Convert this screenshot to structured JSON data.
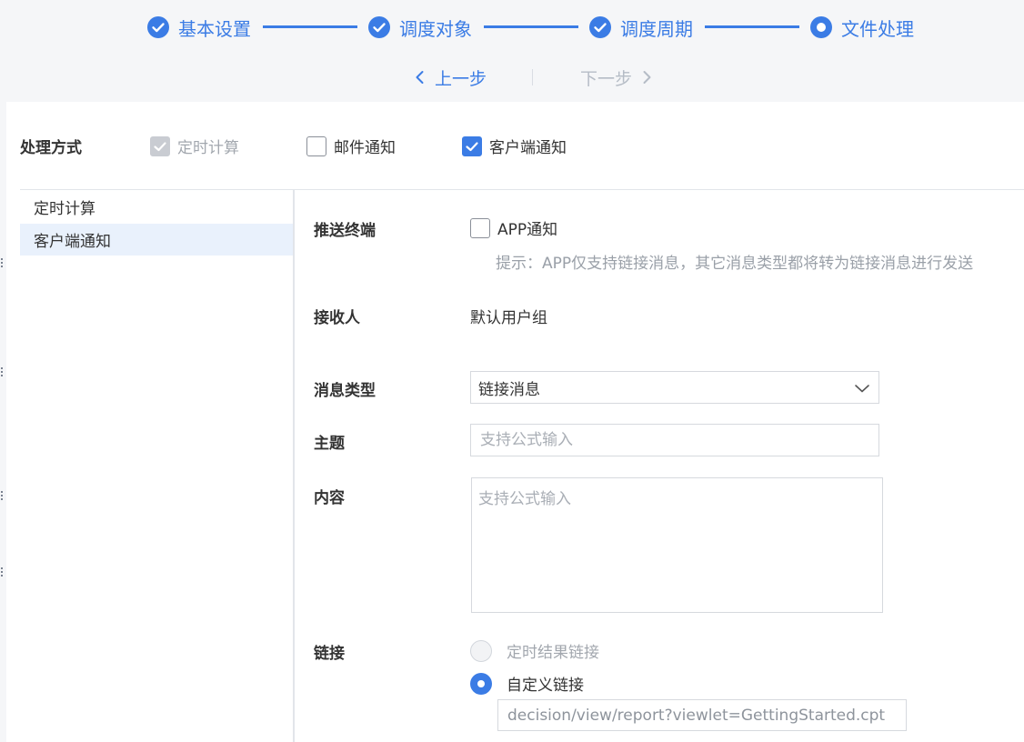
{
  "steps": [
    {
      "label": "基本设置",
      "state": "done"
    },
    {
      "label": "调度对象",
      "state": "done"
    },
    {
      "label": "调度周期",
      "state": "done"
    },
    {
      "label": "文件处理",
      "state": "current"
    }
  ],
  "nav": {
    "prev_label": "上一步",
    "next_label": "下一步"
  },
  "processing": {
    "label": "处理方式",
    "options": [
      {
        "label": "定时计算",
        "checked": true,
        "disabled": true
      },
      {
        "label": "邮件通知",
        "checked": false,
        "disabled": false
      },
      {
        "label": "客户端通知",
        "checked": true,
        "disabled": false
      }
    ]
  },
  "sidebar": {
    "items": [
      {
        "label": "定时计算",
        "active": false
      },
      {
        "label": "客户端通知",
        "active": true
      }
    ]
  },
  "form": {
    "push_terminal": {
      "label": "推送终端",
      "option_label": "APP通知",
      "checked": false,
      "hint": "提示：APP仅支持链接消息，其它消息类型都将转为链接消息进行发送"
    },
    "receiver": {
      "label": "接收人",
      "value": "默认用户组"
    },
    "message_type": {
      "label": "消息类型",
      "value": "链接消息"
    },
    "subject": {
      "label": "主题",
      "placeholder": "支持公式输入",
      "value": ""
    },
    "content": {
      "label": "内容",
      "placeholder": "支持公式输入",
      "value": ""
    },
    "link": {
      "label": "链接",
      "options": [
        {
          "label": "定时结果链接",
          "selected": false,
          "disabled": true
        },
        {
          "label": "自定义链接",
          "selected": true,
          "disabled": false
        }
      ],
      "custom_url": "decision/view/report?viewlet=GettingStarted.cpt"
    }
  },
  "colors": {
    "accent": "#3b7ce5",
    "header_bg": "#f5f6f8",
    "active_bg": "#e9f1fc",
    "muted": "#a2a7ae"
  }
}
